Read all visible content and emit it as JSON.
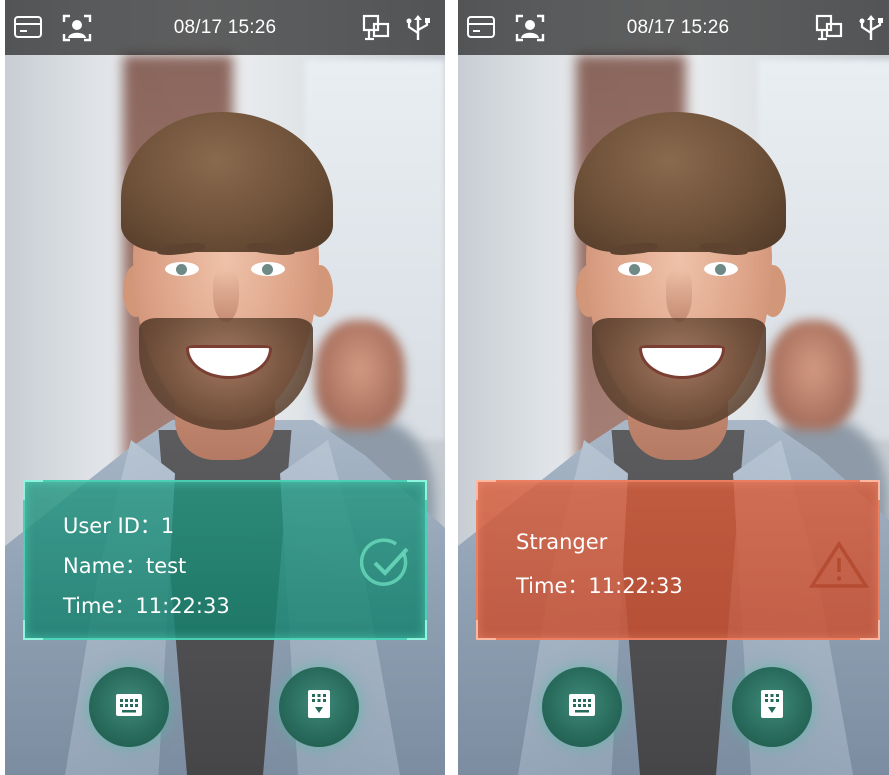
{
  "screens": [
    {
      "status_bar": {
        "time": "08/17 15:26",
        "icons": [
          "card-icon",
          "face-icon",
          "network-icon",
          "usb-icon"
        ]
      },
      "result": {
        "status": "success",
        "lines": [
          "User ID：1",
          "Name：test",
          "Time：11:22:33"
        ],
        "icon": "checkmark-circle-icon",
        "color": "#1f9b84"
      },
      "buttons": [
        "keypad-icon",
        "keypad-verify-icon"
      ]
    },
    {
      "status_bar": {
        "time": "08/17 15:26",
        "icons": [
          "card-icon",
          "face-icon",
          "network-icon",
          "usb-icon"
        ]
      },
      "result": {
        "status": "stranger",
        "lines": [
          "Stranger",
          "Time：11:22:33"
        ],
        "icon": "warning-triangle-icon",
        "color": "#d2603c"
      },
      "buttons": [
        "keypad-icon",
        "keypad-verify-icon"
      ]
    }
  ]
}
